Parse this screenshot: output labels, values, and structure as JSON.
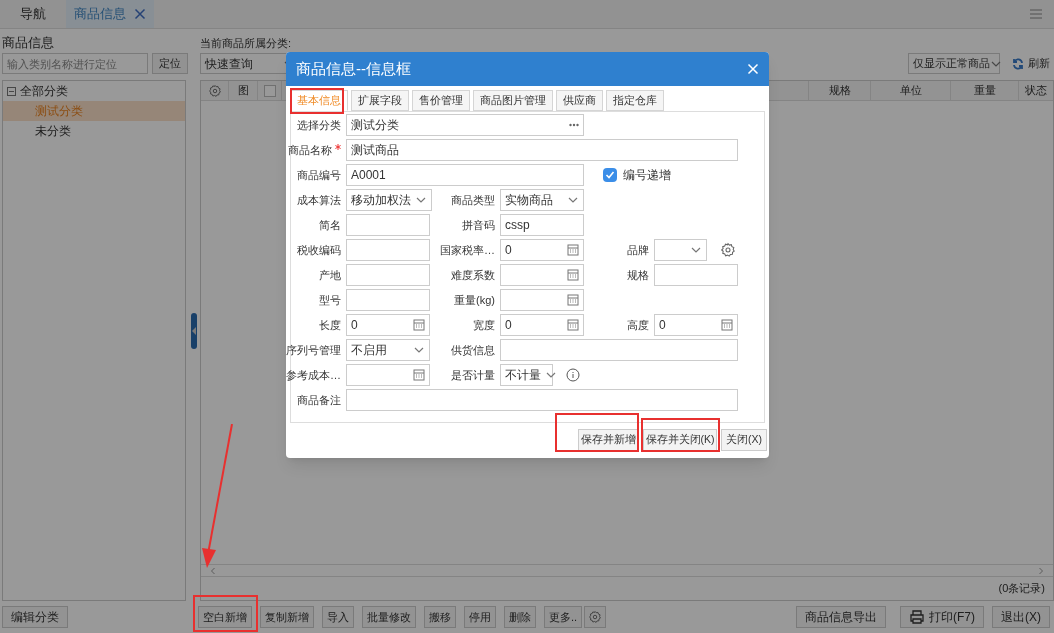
{
  "top_tabs": [
    {
      "label": "导航",
      "selected": false,
      "closable": false
    },
    {
      "label": "商品信息",
      "selected": true,
      "closable": true
    }
  ],
  "left_panel": {
    "title": "商品信息",
    "search": {
      "placeholder": "输入类别名称进行定位"
    },
    "locate_button": "定位",
    "tree": [
      {
        "label": "全部分类",
        "expanded": true,
        "selected": false,
        "children": [
          {
            "label": "测试分类",
            "selected": true
          },
          {
            "label": "未分类",
            "selected": false
          }
        ]
      }
    ],
    "edit_button": "编辑分类"
  },
  "main": {
    "category_label": "当前商品所属分类:",
    "quick_query": "快速查询",
    "filter": "仅显示正常商品",
    "refresh": "刷新",
    "columns": [
      {
        "kind": "gear"
      },
      {
        "kind": "text",
        "label": "图"
      },
      {
        "kind": "checkbox",
        "checked": false
      },
      {
        "kind": "blank"
      },
      {
        "kind": "text",
        "label": "规格"
      },
      {
        "kind": "text",
        "label": "单位"
      },
      {
        "kind": "text",
        "label": "重量"
      },
      {
        "kind": "text",
        "label": "状态"
      }
    ],
    "record_count": "(0条记录)",
    "toolbar_left": [
      "空白新增",
      "复制新增",
      "导入",
      "批量修改",
      "搬移",
      "停用",
      "删除",
      "更多.."
    ],
    "toolbar_right": [
      "商品信息导出",
      "打印(F7)",
      "退出(X)"
    ]
  },
  "dialog": {
    "title": "商品信息--信息框",
    "tabs": [
      {
        "label": "基本信息",
        "selected": true
      },
      {
        "label": "扩展字段",
        "selected": false
      },
      {
        "label": "售价管理",
        "selected": false
      },
      {
        "label": "商品图片管理",
        "selected": false
      },
      {
        "label": "供应商",
        "selected": false
      },
      {
        "label": "指定仓库",
        "selected": false
      }
    ],
    "rows": [
      [
        {
          "kind": "picker",
          "label": "选择分类",
          "value": "测试分类"
        }
      ],
      [
        {
          "kind": "text",
          "label": "商品名称",
          "value": "测试商品",
          "required": true
        }
      ],
      [
        {
          "kind": "text",
          "label": "商品编号",
          "value": "A0001"
        },
        "",
        {
          "kind": "checkbox",
          "label": "编号递增",
          "checked": true
        }
      ],
      [
        {
          "kind": "select",
          "label": "成本算法",
          "value": "移动加权法"
        },
        {
          "kind": "select",
          "label": "商品类型",
          "value": "实物商品"
        }
      ],
      [
        {
          "kind": "text",
          "label": "简名"
        },
        {
          "kind": "text",
          "label": "拼音码",
          "value": "cssp"
        }
      ],
      [
        {
          "kind": "text",
          "label": "税收编码"
        },
        {
          "kind": "number",
          "label": "国家税率…",
          "value": "0"
        },
        {
          "kind": "select",
          "label": "品牌",
          "has_settings": true
        }
      ],
      [
        {
          "kind": "text",
          "label": "产地"
        },
        {
          "kind": "number",
          "label": "难度系数"
        },
        {
          "kind": "text",
          "label": "规格"
        }
      ],
      [
        {
          "kind": "text",
          "label": "型号"
        },
        {
          "kind": "number",
          "label": "重量(kg)"
        }
      ],
      [
        {
          "kind": "number",
          "label": "长度",
          "value": "0"
        },
        {
          "kind": "number",
          "label": "宽度",
          "value": "0"
        },
        {
          "kind": "number",
          "label": "高度",
          "value": "0"
        }
      ],
      [
        {
          "kind": "select",
          "label": "序列号管理",
          "value": "不启用"
        },
        {
          "kind": "text",
          "label": "供货信息"
        }
      ],
      [
        {
          "kind": "number",
          "label": "参考成本…"
        },
        {
          "kind": "select",
          "label": "是否计量",
          "value": "不计量",
          "has_info": true
        }
      ],
      [
        {
          "kind": "text",
          "label": "商品备注"
        }
      ]
    ],
    "buttons": [
      "保存并新增",
      "保存并关闭(K)",
      "关闭(X)"
    ]
  }
}
